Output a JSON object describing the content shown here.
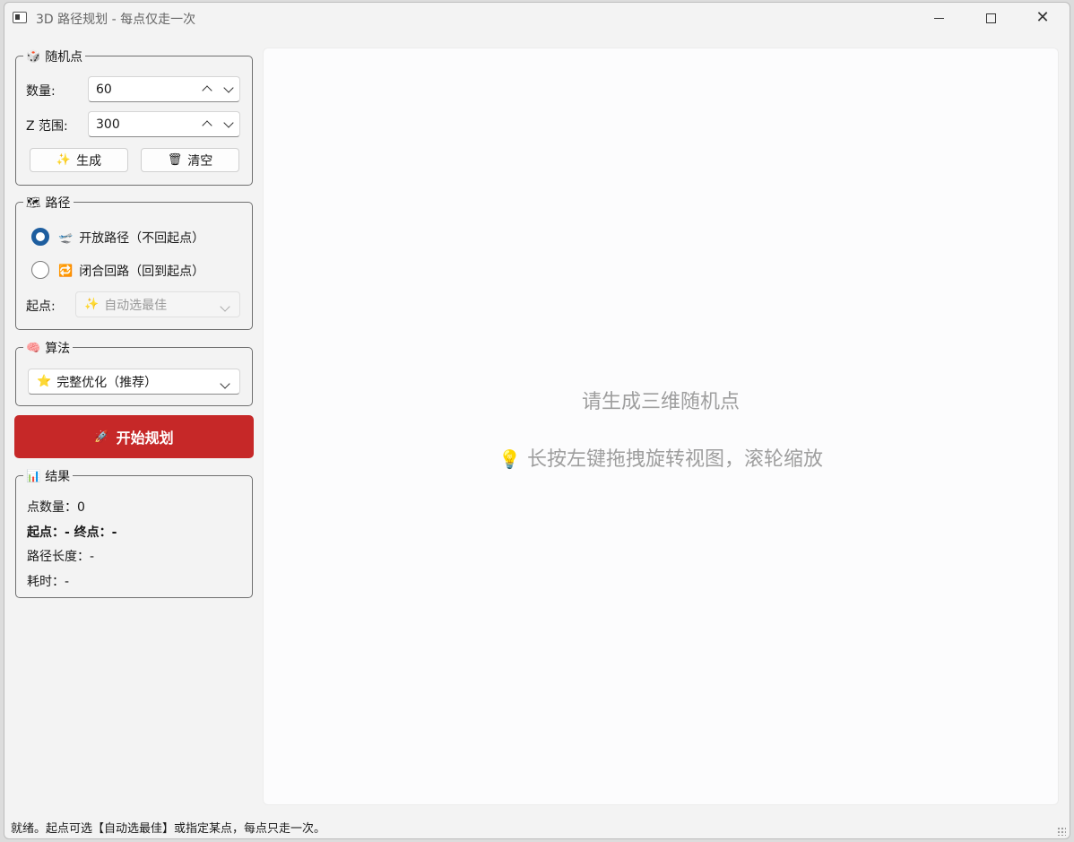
{
  "window": {
    "title": "3D 路径规划 - 每点仅走一次"
  },
  "random_points": {
    "title": "随机点",
    "icon": "🎲",
    "count_label": "数量:",
    "count_value": "60",
    "z_label": "Z 范围:",
    "z_value": "300",
    "generate_label": "生成",
    "generate_icon": "✨",
    "clear_label": "清空",
    "clear_icon": "🗑"
  },
  "path": {
    "title": "路径",
    "icon": "🗺",
    "open_label": "开放路径（不回起点）",
    "open_icon": "🛫",
    "closed_label": "闭合回路（回到起点）",
    "closed_icon": "🔁",
    "start_label": "起点:",
    "start_value": "自动选最佳",
    "start_icon": "✨"
  },
  "algorithm": {
    "title": "算法",
    "icon": "🧠",
    "value": "完整优化（推荐）",
    "value_icon": "⭐"
  },
  "start_button": {
    "label": "开始规划",
    "icon": "🚀"
  },
  "results": {
    "title": "结果",
    "icon": "📊",
    "point_count": "点数量：0",
    "start_end": "起点：-   终点：-",
    "path_length": "路径长度：-",
    "elapsed": "耗时：-"
  },
  "canvas": {
    "placeholder": "请生成三维随机点",
    "hint": "长按左键拖拽旋转视图，滚轮缩放",
    "hint_icon": "💡"
  },
  "status": {
    "text": "就绪。起点可选【自动选最佳】或指定某点，每点只走一次。"
  }
}
